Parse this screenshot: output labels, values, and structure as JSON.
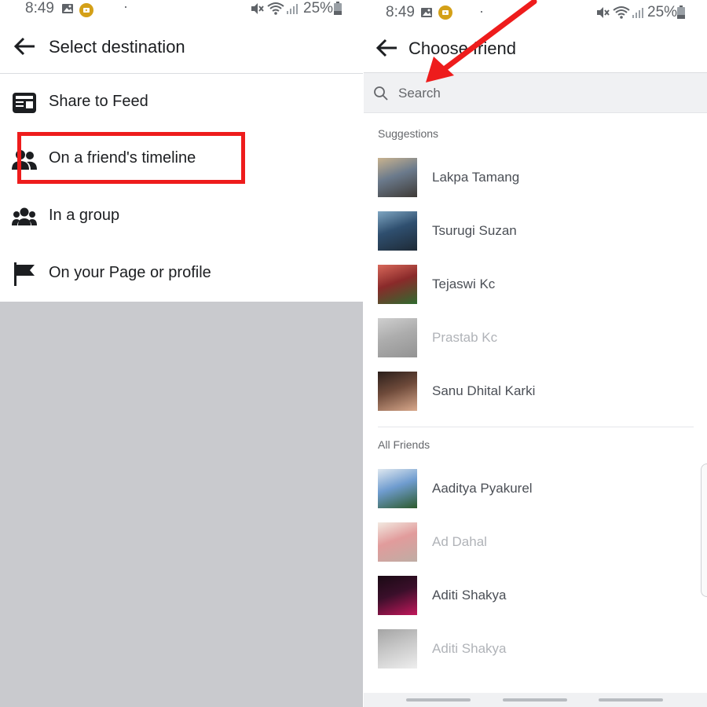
{
  "left": {
    "status": {
      "time": "8:49",
      "battery": "25%",
      "icons": [
        "gallery-icon",
        "notification-badge-icon",
        "dot-icon",
        "mute-icon",
        "wifi-icon",
        "signal-icon",
        "battery-icon"
      ]
    },
    "header": {
      "title": "Select destination",
      "back_icon": "back-arrow-icon"
    },
    "options": [
      {
        "label": "Share to Feed",
        "icon": "feed-icon"
      },
      {
        "label": "On a friend's timeline",
        "icon": "friends-icon"
      },
      {
        "label": "In a group",
        "icon": "group-icon"
      },
      {
        "label": "On your Page or profile",
        "icon": "flag-icon"
      }
    ]
  },
  "right": {
    "status": {
      "time": "8:49",
      "battery": "25%"
    },
    "header": {
      "title": "Choose friend",
      "back_icon": "back-arrow-icon"
    },
    "search": {
      "placeholder": "Search",
      "value": ""
    },
    "suggestions_heading": "Suggestions",
    "suggestions": [
      {
        "name": "Lakpa Tamang",
        "dim": false,
        "colors": [
          "#6b7a8c",
          "#3e3a36",
          "#c9b38f"
        ]
      },
      {
        "name": "Tsurugi Suzan",
        "dim": false,
        "colors": [
          "#2f4f6f",
          "#1e2a36",
          "#7fa6c2"
        ]
      },
      {
        "name": "Tejaswi Kc",
        "dim": false,
        "colors": [
          "#8a2a2a",
          "#2f6b2f",
          "#d8685a"
        ]
      },
      {
        "name": "Prastab Kc",
        "dim": true,
        "colors": [
          "#6a6a6a",
          "#3a3a3a",
          "#a8a8a8"
        ]
      },
      {
        "name": "Sanu Dhital Karki",
        "dim": false,
        "colors": [
          "#6e4a3a",
          "#d9a98c",
          "#2a1e1a"
        ]
      }
    ],
    "all_friends_heading": "All Friends",
    "all_friends": [
      {
        "name": "Aaditya Pyakurel",
        "dim": false,
        "colors": [
          "#6f9ccf",
          "#2c5a2c",
          "#dfe8f0"
        ]
      },
      {
        "name": "Ad Dahal",
        "dim": true,
        "colors": [
          "#c94a4a",
          "#8a6a5a",
          "#e8d8c8"
        ]
      },
      {
        "name": "Aditi Shakya",
        "dim": false,
        "colors": [
          "#3a0f2a",
          "#c2185b",
          "#1a0a14"
        ]
      },
      {
        "name": "Aditi Shakya",
        "dim": true,
        "colors": [
          "#9a9a9a",
          "#e0e0e0",
          "#5a5a5a"
        ]
      }
    ]
  },
  "annotation": {
    "box_color": "#ee1c1c",
    "arrow_color": "#ee1c1c"
  },
  "colors": {
    "text": "#1c1e21",
    "muted": "#65676b",
    "dim_text": "#b0b3b8",
    "gray_overlay": "#c9cace",
    "search_bg": "#f0f1f3"
  }
}
